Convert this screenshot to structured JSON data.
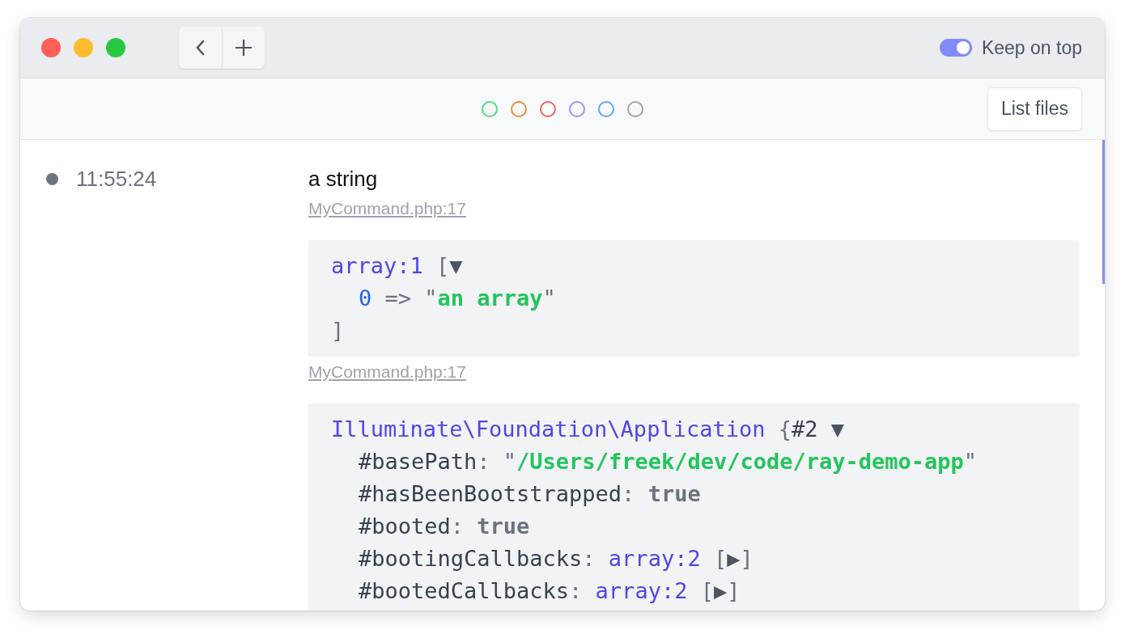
{
  "titlebar": {
    "keep_on_top": {
      "label": "Keep on top",
      "on": true
    }
  },
  "toolbar": {
    "color_filters": [
      {
        "color": "#4ade80"
      },
      {
        "color": "#f0883e"
      },
      {
        "color": "#ef6461"
      },
      {
        "color": "#a78bfa"
      },
      {
        "color": "#60a5fa"
      },
      {
        "color": "#9ca3af"
      }
    ],
    "button": "List files"
  },
  "entries": [
    {
      "time": "11:55:24",
      "items": [
        {
          "kind": "text",
          "text": "a string",
          "origin": "MyCommand.php:17"
        },
        {
          "kind": "code",
          "lines": [
            {
              "indent": false,
              "tokens": [
                {
                  "kind": "type",
                  "text": "array:1"
                },
                {
                  "kind": "punct",
                  "text": " ["
                },
                {
                  "kind": "caret",
                  "text": "▼"
                }
              ]
            },
            {
              "indent": true,
              "tokens": [
                {
                  "kind": "number",
                  "text": "0"
                },
                {
                  "kind": "punct",
                  "text": " => \""
                },
                {
                  "kind": "string",
                  "text": "an array"
                },
                {
                  "kind": "punct",
                  "text": "\""
                }
              ]
            },
            {
              "indent": false,
              "tokens": [
                {
                  "kind": "punct",
                  "text": "]"
                }
              ]
            }
          ],
          "origin": "MyCommand.php:17"
        },
        {
          "kind": "code",
          "lines": [
            {
              "indent": false,
              "tokens": [
                {
                  "kind": "type",
                  "text": "Illuminate\\Foundation\\Application"
                },
                {
                  "kind": "punct",
                  "text": " {"
                },
                {
                  "kind": "key",
                  "text": "#2"
                },
                {
                  "kind": "caret",
                  "text": " ▼"
                }
              ]
            },
            {
              "indent": true,
              "tokens": [
                {
                  "kind": "key",
                  "text": "#basePath"
                },
                {
                  "kind": "punct",
                  "text": ": \""
                },
                {
                  "kind": "string",
                  "text": "/Users/freek/dev/code/ray-demo-app"
                },
                {
                  "kind": "punct",
                  "text": "\""
                }
              ]
            },
            {
              "indent": true,
              "tokens": [
                {
                  "kind": "key",
                  "text": "#hasBeenBootstrapped"
                },
                {
                  "kind": "punct",
                  "text": ": "
                },
                {
                  "kind": "bool",
                  "text": "true"
                }
              ]
            },
            {
              "indent": true,
              "tokens": [
                {
                  "kind": "key",
                  "text": "#booted"
                },
                {
                  "kind": "punct",
                  "text": ": "
                },
                {
                  "kind": "bool",
                  "text": "true"
                }
              ]
            },
            {
              "indent": true,
              "tokens": [
                {
                  "kind": "key",
                  "text": "#bootingCallbacks"
                },
                {
                  "kind": "punct",
                  "text": ": "
                },
                {
                  "kind": "type",
                  "text": "array:2"
                },
                {
                  "kind": "punct",
                  "text": " ["
                },
                {
                  "kind": "caret",
                  "text": "▶"
                },
                {
                  "kind": "punct",
                  "text": "]"
                }
              ]
            },
            {
              "indent": true,
              "tokens": [
                {
                  "kind": "key",
                  "text": "#bootedCallbacks"
                },
                {
                  "kind": "punct",
                  "text": ": "
                },
                {
                  "kind": "type",
                  "text": "array:2"
                },
                {
                  "kind": "punct",
                  "text": " ["
                },
                {
                  "kind": "caret",
                  "text": "▶"
                },
                {
                  "kind": "punct",
                  "text": "]"
                }
              ]
            }
          ]
        }
      ]
    }
  ]
}
